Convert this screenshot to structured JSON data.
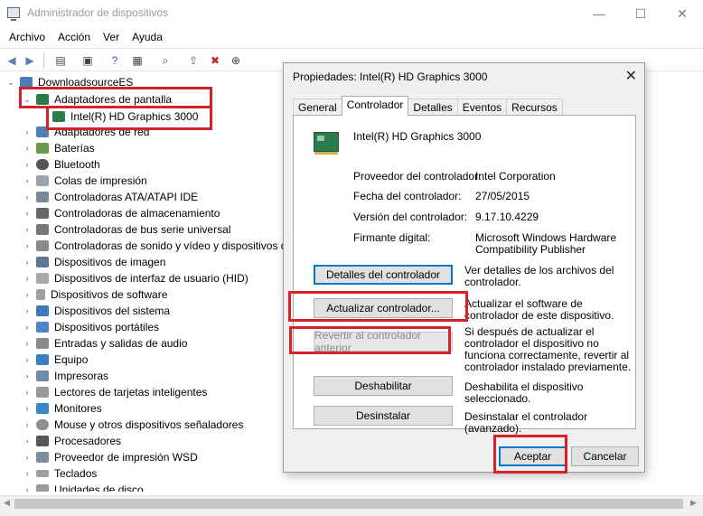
{
  "window": {
    "title": "Administrador de dispositivos",
    "minimize": "—",
    "maximize": "☐",
    "close": "✕"
  },
  "menu": [
    "Archivo",
    "Acción",
    "Ver",
    "Ayuda"
  ],
  "tree": {
    "root": "DownloadsourceES",
    "expanded": "Adaptadores de pantalla",
    "child": "Intel(R) HD Graphics 3000",
    "categories": [
      "Adaptadores de red",
      "Baterías",
      "Bluetooth",
      "Colas de impresión",
      "Controladoras ATA/ATAPI IDE",
      "Controladoras de almacenamiento",
      "Controladoras de bus serie universal",
      "Controladoras de sonido y vídeo y dispositivos de",
      "Dispositivos de imagen",
      "Dispositivos de interfaz de usuario (HID)",
      "Dispositivos de software",
      "Dispositivos del sistema",
      "Dispositivos portátiles",
      "Entradas y salidas de audio",
      "Equipo",
      "Impresoras",
      "Lectores de tarjetas inteligentes",
      "Monitores",
      "Mouse y otros dispositivos señaladores",
      "Procesadores",
      "Proveedor de impresión WSD",
      "Teclados",
      "Unidades de disco"
    ]
  },
  "dialog": {
    "title": "Propiedades: Intel(R) HD Graphics 3000",
    "close": "✕",
    "tabs": [
      "General",
      "Controlador",
      "Detalles",
      "Eventos",
      "Recursos"
    ],
    "active_tab": "Controlador",
    "device_name": "Intel(R) HD Graphics 3000",
    "props": [
      {
        "label": "Proveedor del controlador:",
        "value": "Intel Corporation"
      },
      {
        "label": "Fecha del controlador:",
        "value": "27/05/2015"
      },
      {
        "label": "Versión del controlador:",
        "value": "9.17.10.4229"
      },
      {
        "label": "Firmante digital:",
        "value": "Microsoft Windows Hardware Compatibility Publisher"
      }
    ],
    "buttons": [
      {
        "label": "Detalles del controlador",
        "desc": "Ver detalles de los archivos del controlador.",
        "disabled": false
      },
      {
        "label": "Actualizar controlador...",
        "desc": "Actualizar el software de controlador de este dispositivo.",
        "disabled": false
      },
      {
        "label": "Revertir al controlador anterior",
        "desc": "Si después de actualizar el controlador el dispositivo no funciona correctamente, revertir al controlador instalado previamente.",
        "disabled": true
      },
      {
        "label": "Deshabilitar",
        "desc": "Deshabilita el dispositivo seleccionado.",
        "disabled": false
      },
      {
        "label": "Desinstalar",
        "desc": "Desinstalar el controlador (avanzado).",
        "disabled": false
      }
    ],
    "ok": "Aceptar",
    "cancel": "Cancelar"
  },
  "colors": {
    "highlight": "#d6232a",
    "focus": "#0078d7"
  }
}
